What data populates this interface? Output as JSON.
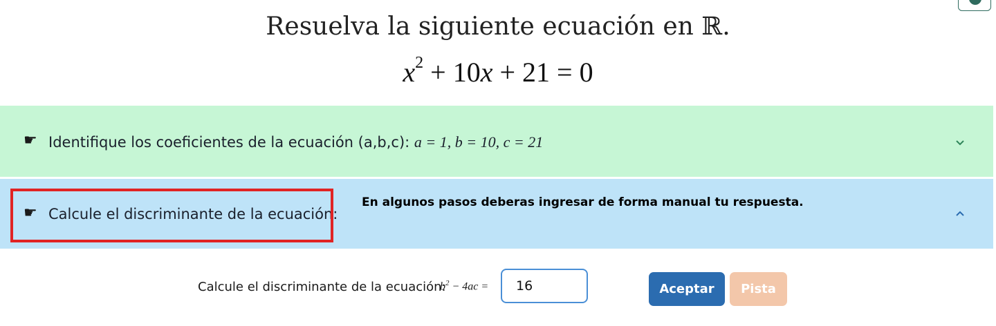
{
  "heading": "Resuelva la siguiente ecuación en ℝ.",
  "equation": {
    "a_term": "x",
    "exp": "2",
    "rest": " + 10",
    "rest_var": "x",
    "tail": " + 21 = 0"
  },
  "steps": [
    {
      "icon": "hand-pointing-right-icon",
      "label": "Identifique los coeficientes de la ecuación (a,b,c):",
      "math": "a = 1, b = 10, c = 21",
      "state": "collapsed"
    },
    {
      "icon": "hand-pointing-right-icon",
      "label": "Calcule el discriminante de la ecuación:",
      "state": "expanded"
    }
  ],
  "note": "En algunos pasos deberas ingresar de forma manual tu respuesta.",
  "answer": {
    "label": "Calcule el discriminante de la ecuación:",
    "math_prefix": "b",
    "math_exp": "2",
    "math_suffix": " − 4ac =",
    "value": "16"
  },
  "buttons": {
    "accept": "Aceptar",
    "hint": "Pista"
  },
  "colors": {
    "step_done_bg": "#c6f6d5",
    "step_active_bg": "#bee3f8",
    "accept": "#2b6cb0",
    "hint_disabled": "#f3c7aa",
    "highlight": "#e02424"
  }
}
